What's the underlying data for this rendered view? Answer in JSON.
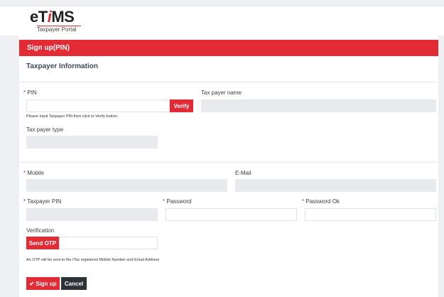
{
  "logo": {
    "brand_pre": "eT",
    "brand_i": "i",
    "brand_post": "MS",
    "subtitle": "Taxpayer Portal"
  },
  "header": {
    "title": "Sign up(PIN)"
  },
  "section_title": "Taxpayer Information",
  "form": {
    "required_mark": "*",
    "pin": {
      "label": "PIN",
      "value": "",
      "verify_label": "Verify",
      "help": "Please Input Taxpayer PIN then click to Verify button."
    },
    "taxpayer_name": {
      "label": "Tax payer name",
      "value": ""
    },
    "taxpayer_type": {
      "label": "Tax payer type",
      "value": ""
    },
    "mobile": {
      "label": "Mobile",
      "value": ""
    },
    "email": {
      "label": "E-Mail",
      "value": ""
    },
    "taxpayer_pin": {
      "label": "Taxpayer PIN",
      "value": ""
    },
    "password": {
      "label": "Password",
      "value": ""
    },
    "password_ok": {
      "label": "Password Ok",
      "value": ""
    },
    "verification": {
      "label": "Verification",
      "send_otp_label": "Send OTP",
      "value": "",
      "note": "An OTP will be sent to the ITax registered Mobile Number and Email Address"
    }
  },
  "actions": {
    "signup_label": "Sign up",
    "cancel_label": "Cancel"
  },
  "colors": {
    "accent": "#e32b36",
    "dark": "#2e3338"
  }
}
